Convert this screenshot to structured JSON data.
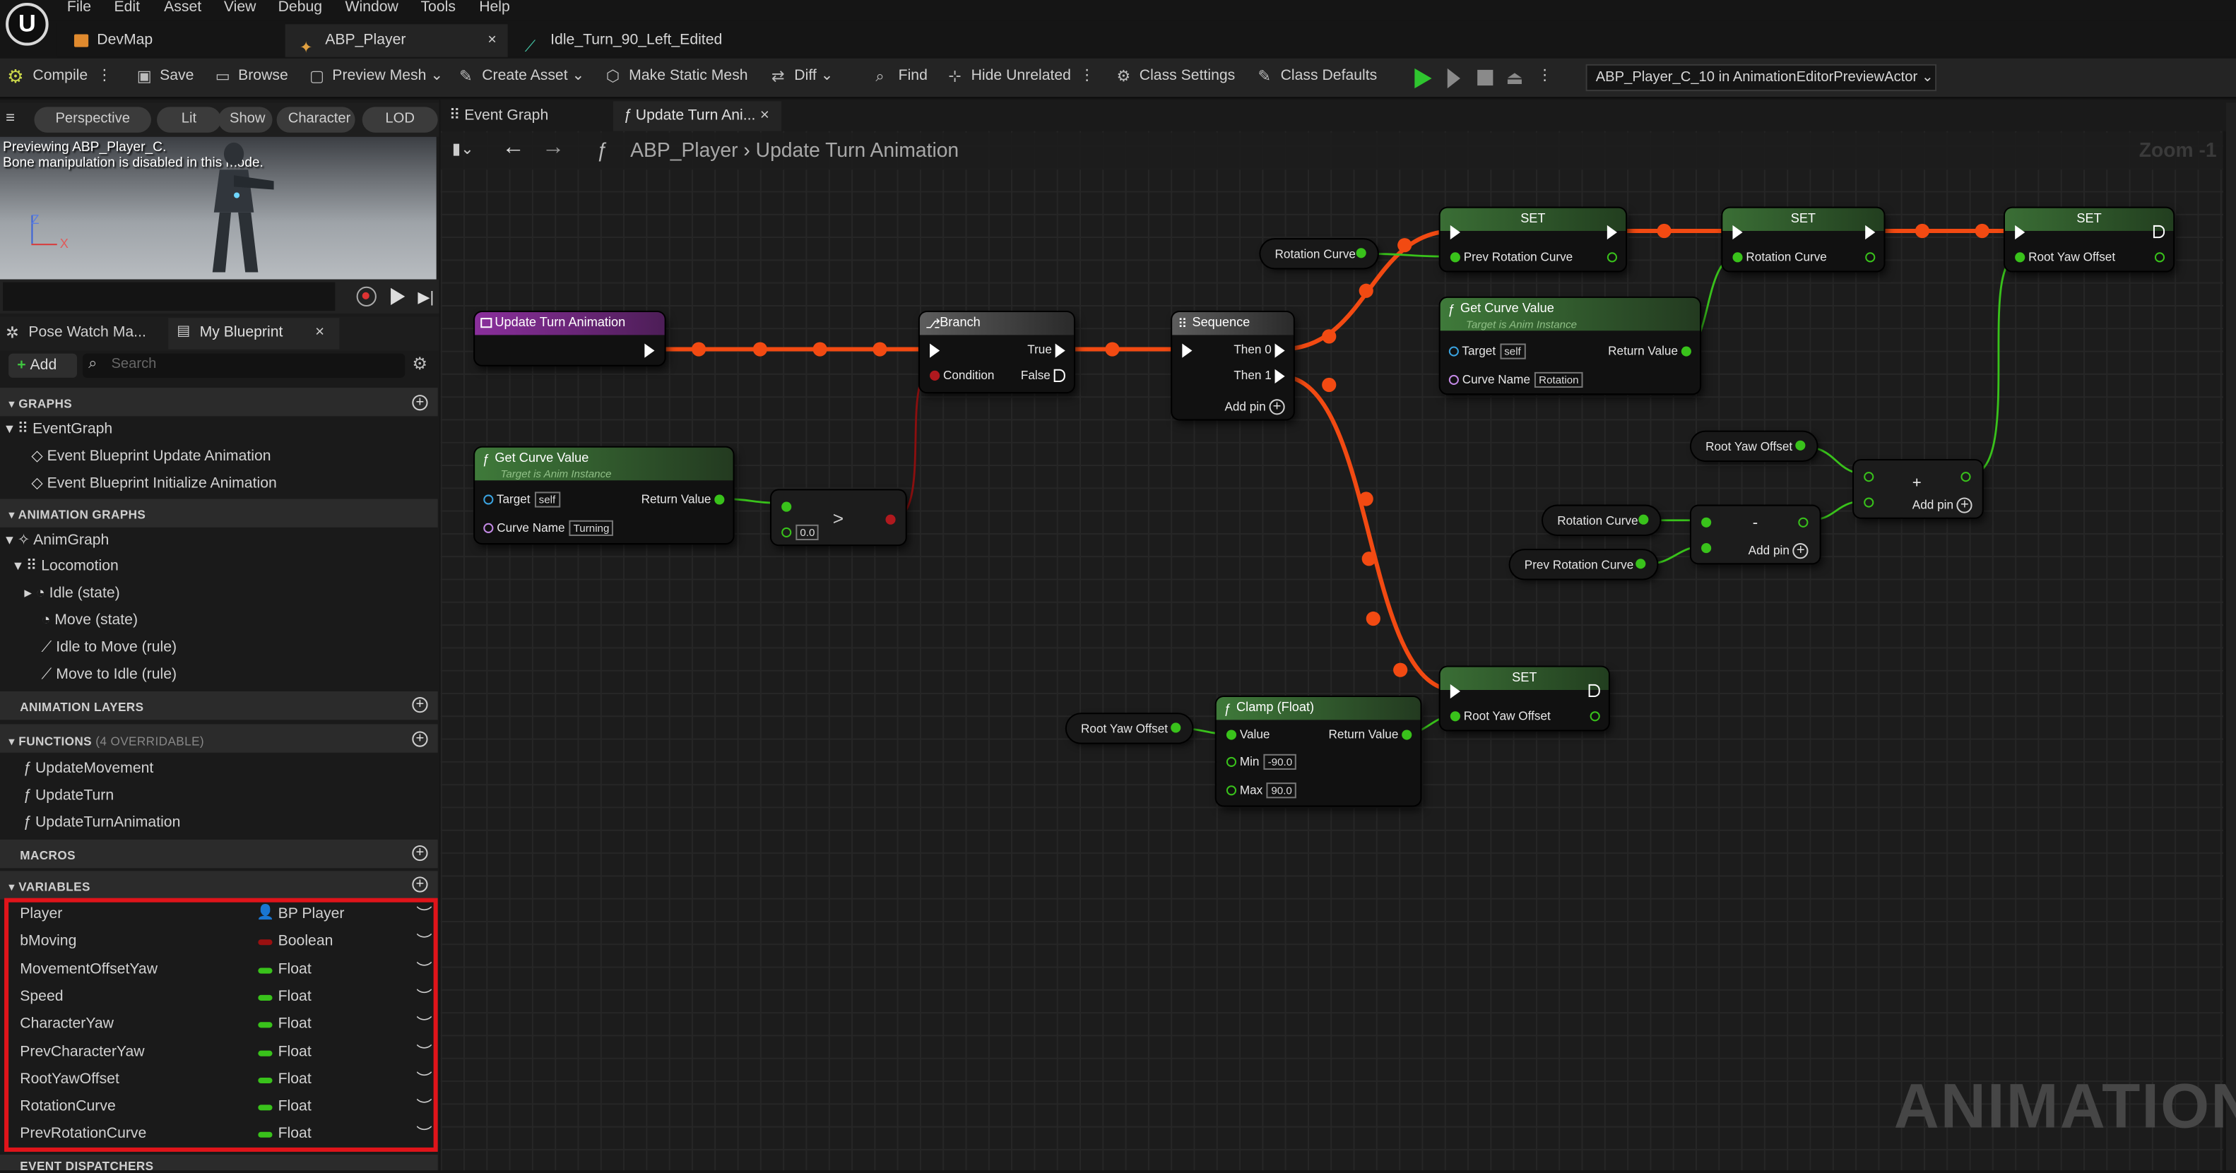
{
  "menu": [
    "File",
    "Edit",
    "Asset",
    "View",
    "Debug",
    "Window",
    "Tools",
    "Help"
  ],
  "tabs": [
    {
      "label": "DevMap"
    },
    {
      "label": "ABP_Player",
      "close": "×"
    },
    {
      "label": "Idle_Turn_90_Left_Edited"
    }
  ],
  "toolbar": {
    "compile": "Compile",
    "save": "Save",
    "browse": "Browse",
    "preview_mesh": "Preview Mesh",
    "create_asset": "Create Asset",
    "make_static_mesh": "Make Static Mesh",
    "diff": "Diff",
    "find": "Find",
    "hide_unrelated": "Hide Unrelated",
    "class_settings": "Class Settings",
    "class_defaults": "Class Defaults",
    "debug_object": "ABP_Player_C_10 in AnimationEditorPreviewActor"
  },
  "viewport": {
    "perspective": "Perspective",
    "lit": "Lit",
    "show": "Show",
    "character": "Character",
    "lod": "LOD Auto",
    "line1": "Previewing ABP_Player_C.",
    "line2": "Bone manipulation is disabled in this mode.",
    "axis_z": "Z",
    "axis_x": "X"
  },
  "panel_tabs": {
    "pose_watch": "Pose Watch Ma...",
    "my_blueprint": "My Blueprint",
    "close": "×"
  },
  "add_label": "Add",
  "search_placeholder": "Search",
  "sections": {
    "graphs": "GRAPHS",
    "anim_graphs": "ANIMATION GRAPHS",
    "anim_layers": "ANIMATION LAYERS",
    "functions": "FUNCTIONS",
    "functions_note": "(4 OVERRIDABLE)",
    "macros": "MACROS",
    "variables": "VARIABLES",
    "dispatchers": "EVENT DISPATCHERS"
  },
  "graphs": {
    "event_graph": "EventGraph",
    "items": [
      "Event Blueprint Update Animation",
      "Event Blueprint Initialize Animation"
    ]
  },
  "anim_graphs": {
    "anim_graph": "AnimGraph",
    "locomotion": "Locomotion",
    "items": [
      "Idle (state)",
      "Move (state)",
      "Idle to Move (rule)",
      "Move to Idle (rule)"
    ]
  },
  "functions": [
    "UpdateMovement",
    "UpdateTurn",
    "UpdateTurnAnimation"
  ],
  "variables": [
    {
      "name": "Player",
      "type": "BP Player",
      "color": "#3a8de0"
    },
    {
      "name": "bMoving",
      "type": "Boolean",
      "color": "#9a1010"
    },
    {
      "name": "MovementOffsetYaw",
      "type": "Float",
      "color": "#39c21b"
    },
    {
      "name": "Speed",
      "type": "Float",
      "color": "#39c21b"
    },
    {
      "name": "CharacterYaw",
      "type": "Float",
      "color": "#39c21b"
    },
    {
      "name": "PrevCharacterYaw",
      "type": "Float",
      "color": "#39c21b"
    },
    {
      "name": "RootYawOffset",
      "type": "Float",
      "color": "#39c21b"
    },
    {
      "name": "RotationCurve",
      "type": "Float",
      "color": "#39c21b"
    },
    {
      "name": "PrevRotationCurve",
      "type": "Float",
      "color": "#39c21b"
    }
  ],
  "graph_tabs": {
    "event_graph": "Event Graph",
    "update_turn": "Update Turn Ani...",
    "close": "×"
  },
  "breadcrumb": {
    "bp": "ABP_Player",
    "fn": "Update Turn Animation"
  },
  "zoom": "Zoom -1",
  "watermark": "ANIMATION",
  "nodes": {
    "entry": "Update Turn Animation",
    "get_curve": "Get Curve Value",
    "get_curve_sub": "Target is Anim Instance",
    "target": "Target",
    "self": "self",
    "return_value": "Return Value",
    "curve_name": "Curve Name",
    "turning": "Turning",
    "rotation": "Rotation",
    "compare_val": "0.0",
    "compare_op": ">",
    "branch": "Branch",
    "true": "True",
    "false": "False",
    "condition": "Condition",
    "sequence": "Sequence",
    "then0": "Then 0",
    "then1": "Then 1",
    "add_pin": "Add pin",
    "set": "SET",
    "prev_rotation_curve": "Prev Rotation Curve",
    "rotation_curve": "Rotation Curve",
    "root_yaw_offset": "Root Yaw Offset",
    "clamp": "Clamp (Float)",
    "value": "Value",
    "min": "Min",
    "max": "Max",
    "min_val": "-90.0",
    "max_val": "90.0",
    "minus": "-",
    "plus": "+"
  }
}
